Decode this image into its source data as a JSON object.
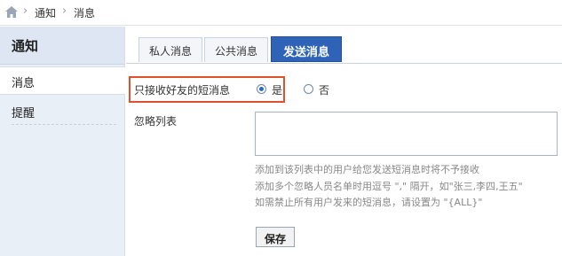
{
  "breadcrumb": {
    "home_icon": "home-icon",
    "items": [
      "通知",
      "消息"
    ]
  },
  "sidebar": {
    "title": "通知",
    "items": [
      {
        "label": "消息",
        "active": true
      },
      {
        "label": "提醒",
        "active": false
      }
    ]
  },
  "tabs": [
    {
      "label": "私人消息",
      "style": "normal"
    },
    {
      "label": "公共消息",
      "style": "normal"
    },
    {
      "label": "发送消息",
      "style": "primary"
    }
  ],
  "form": {
    "friends_only": {
      "label": "只接收好友的短消息",
      "options": [
        {
          "label": "是",
          "checked": true
        },
        {
          "label": "否",
          "checked": false
        }
      ]
    },
    "ignore_list": {
      "label": "忽略列表",
      "value": "",
      "hints": [
        "添加到该列表中的用户给您发送短消息时将不予接收",
        "添加多个忽略人员名单时用逗号 \",\" 隔开，如\"张三,李四,王五\"",
        "如需禁止所有用户发来的短消息，请设置为 \"{ALL}\""
      ]
    },
    "save_label": "保存"
  },
  "colors": {
    "accent": "#2e63b8",
    "highlight_border": "#e0502d",
    "sidebar_bg": "#e9eff7"
  }
}
